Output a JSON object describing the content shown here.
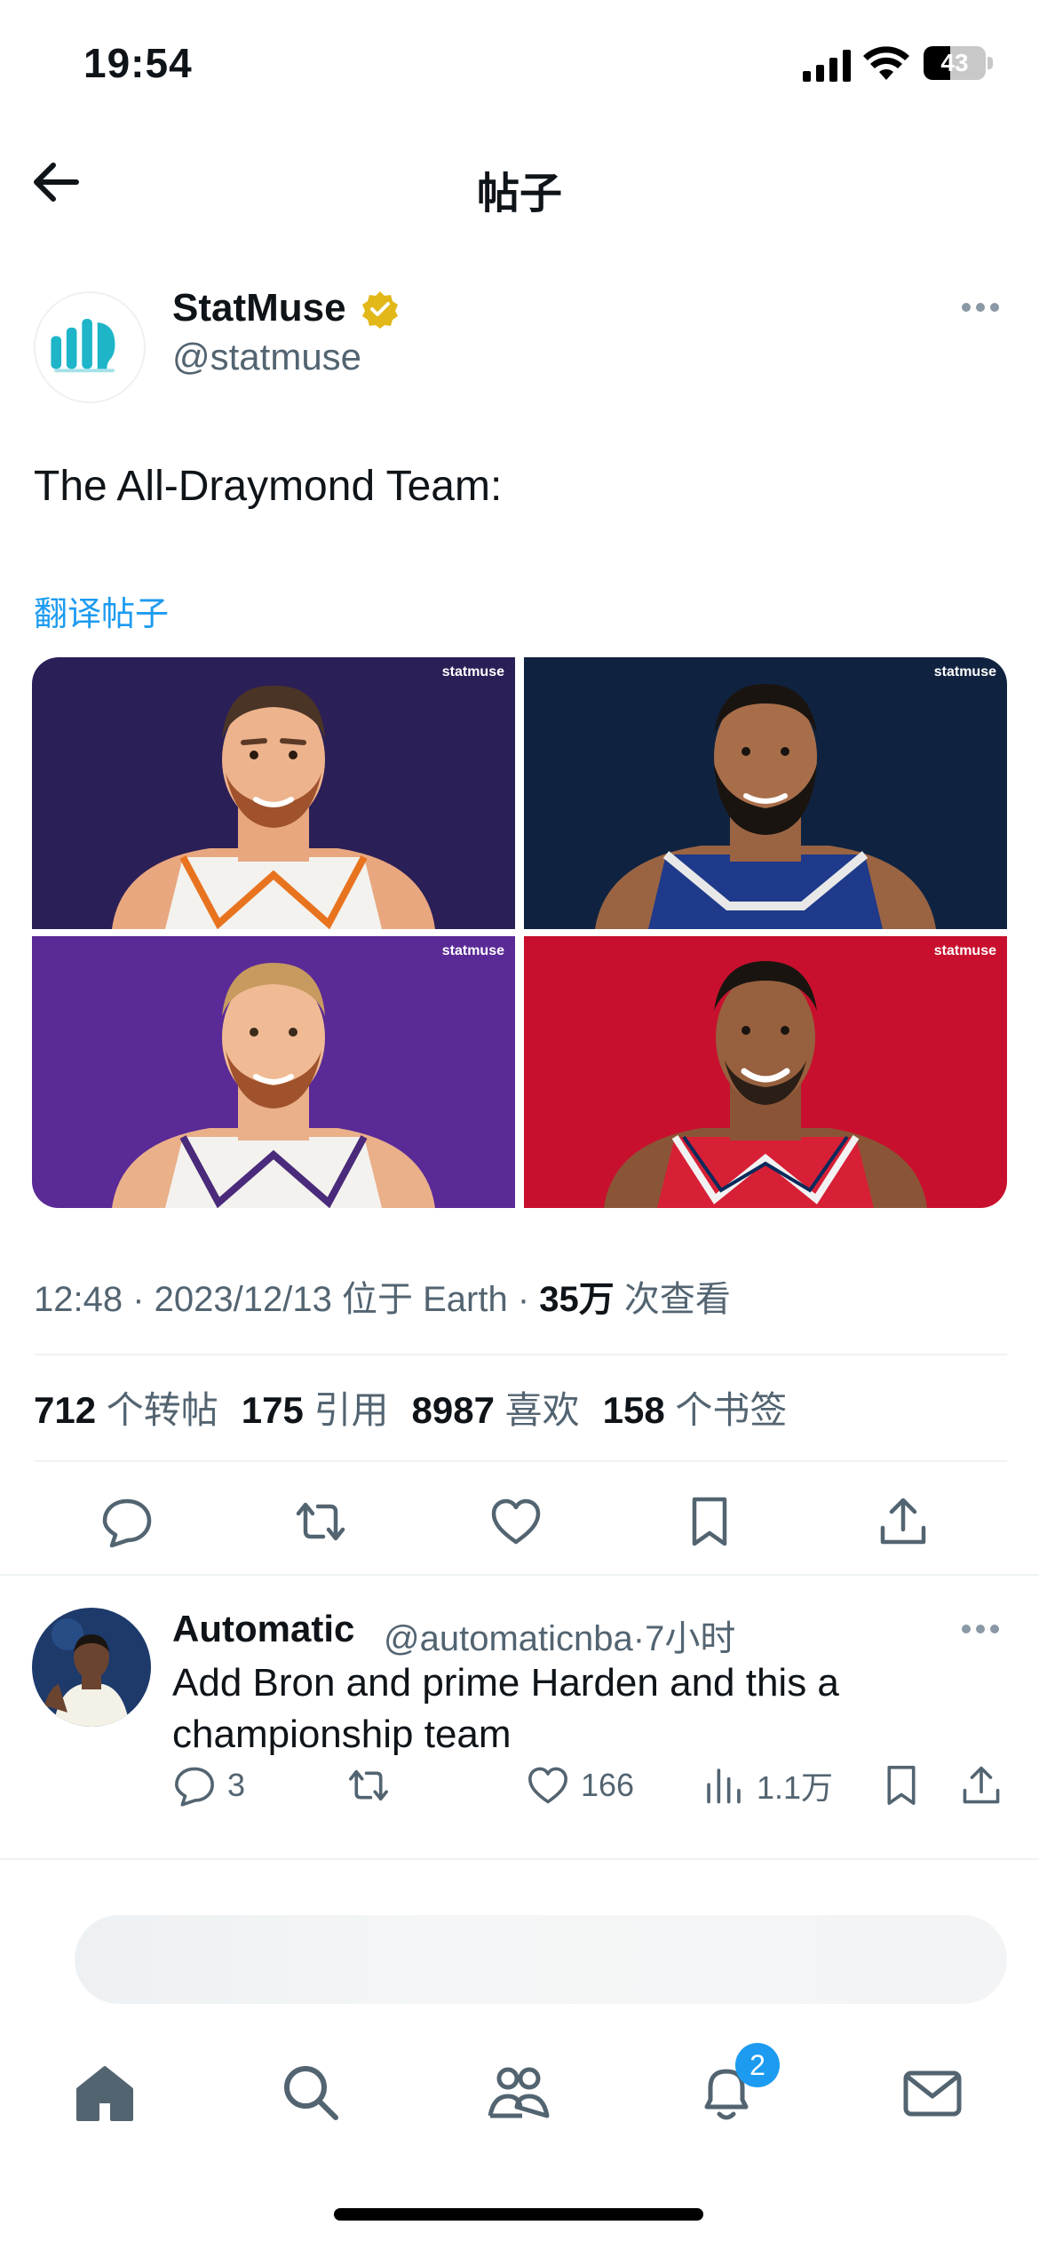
{
  "status_bar": {
    "time": "19:54",
    "battery": "43",
    "battery_level": 0.43
  },
  "header": {
    "title": "帖子"
  },
  "tweet": {
    "author_name": "StatMuse",
    "author_handle": "@statmuse",
    "text": "The All-Draymond Team:",
    "translate": "翻译帖子",
    "media_watermark": "statmuse",
    "meta": {
      "time": "12:48",
      "sep1": " · ",
      "date": "2023/12/13",
      "location": " 位于 Earth",
      "sep2": " · ",
      "views_count": "35万",
      "views_label": " 次查看"
    },
    "stats": {
      "retweets_count": "712",
      "retweets_label": " 个转帖",
      "quotes_count": "175",
      "quotes_label": " 引用",
      "likes_count": "8987",
      "likes_label": " 喜欢",
      "bookmarks_count": "158",
      "bookmarks_label": " 个书签"
    }
  },
  "reply": {
    "name": "Automatic",
    "handle": "@automaticnba",
    "time": "·7小时",
    "text": "Add Bron and prime Harden and this a championship team",
    "replies": "3",
    "likes": "166",
    "views": "1.1万"
  },
  "tabbar": {
    "notifications_badge": "2"
  },
  "colors": {
    "accent": "#1d9bf0",
    "verified_gold": "#e2b719",
    "tile_backgrounds": [
      "#2b1f57",
      "#0f2340",
      "#5a2a96",
      "#c8102e"
    ]
  }
}
